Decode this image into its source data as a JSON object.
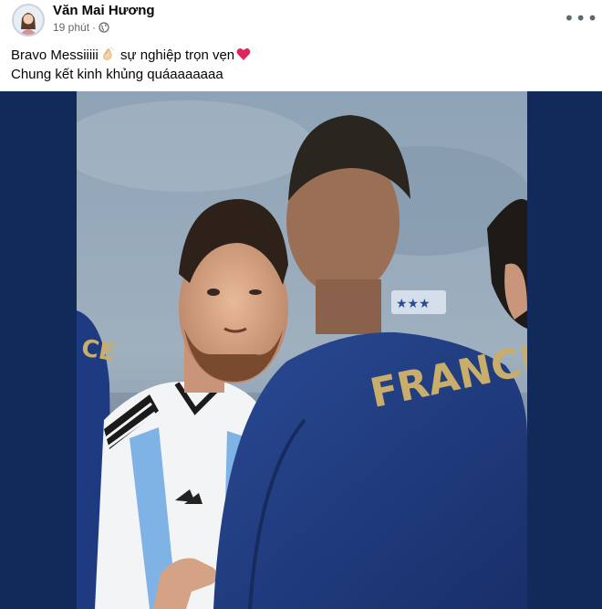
{
  "post": {
    "author": "Văn Mai Hương",
    "time": "19 phút",
    "separator": "·",
    "privacy_icon": "globe-icon",
    "more_icon": "more-options-icon",
    "more_label": "•••"
  },
  "caption": {
    "line1_a": "Bravo Messiiiii",
    "emoji_1": "clapping-hands-emoji",
    "line1_b": "sự nghiệp trọn vẹn",
    "emoji_2": "red-heart-emoji",
    "line2": "Chung kết kinh khủng quáaaaaaaa"
  },
  "photo": {
    "jersey_text": "FRANCE"
  },
  "colors": {
    "background_side": "#112a5a",
    "france_jersey": "#1f3d86",
    "argentina_blue": "#7fb3e6",
    "text_secondary": "#65676b"
  }
}
